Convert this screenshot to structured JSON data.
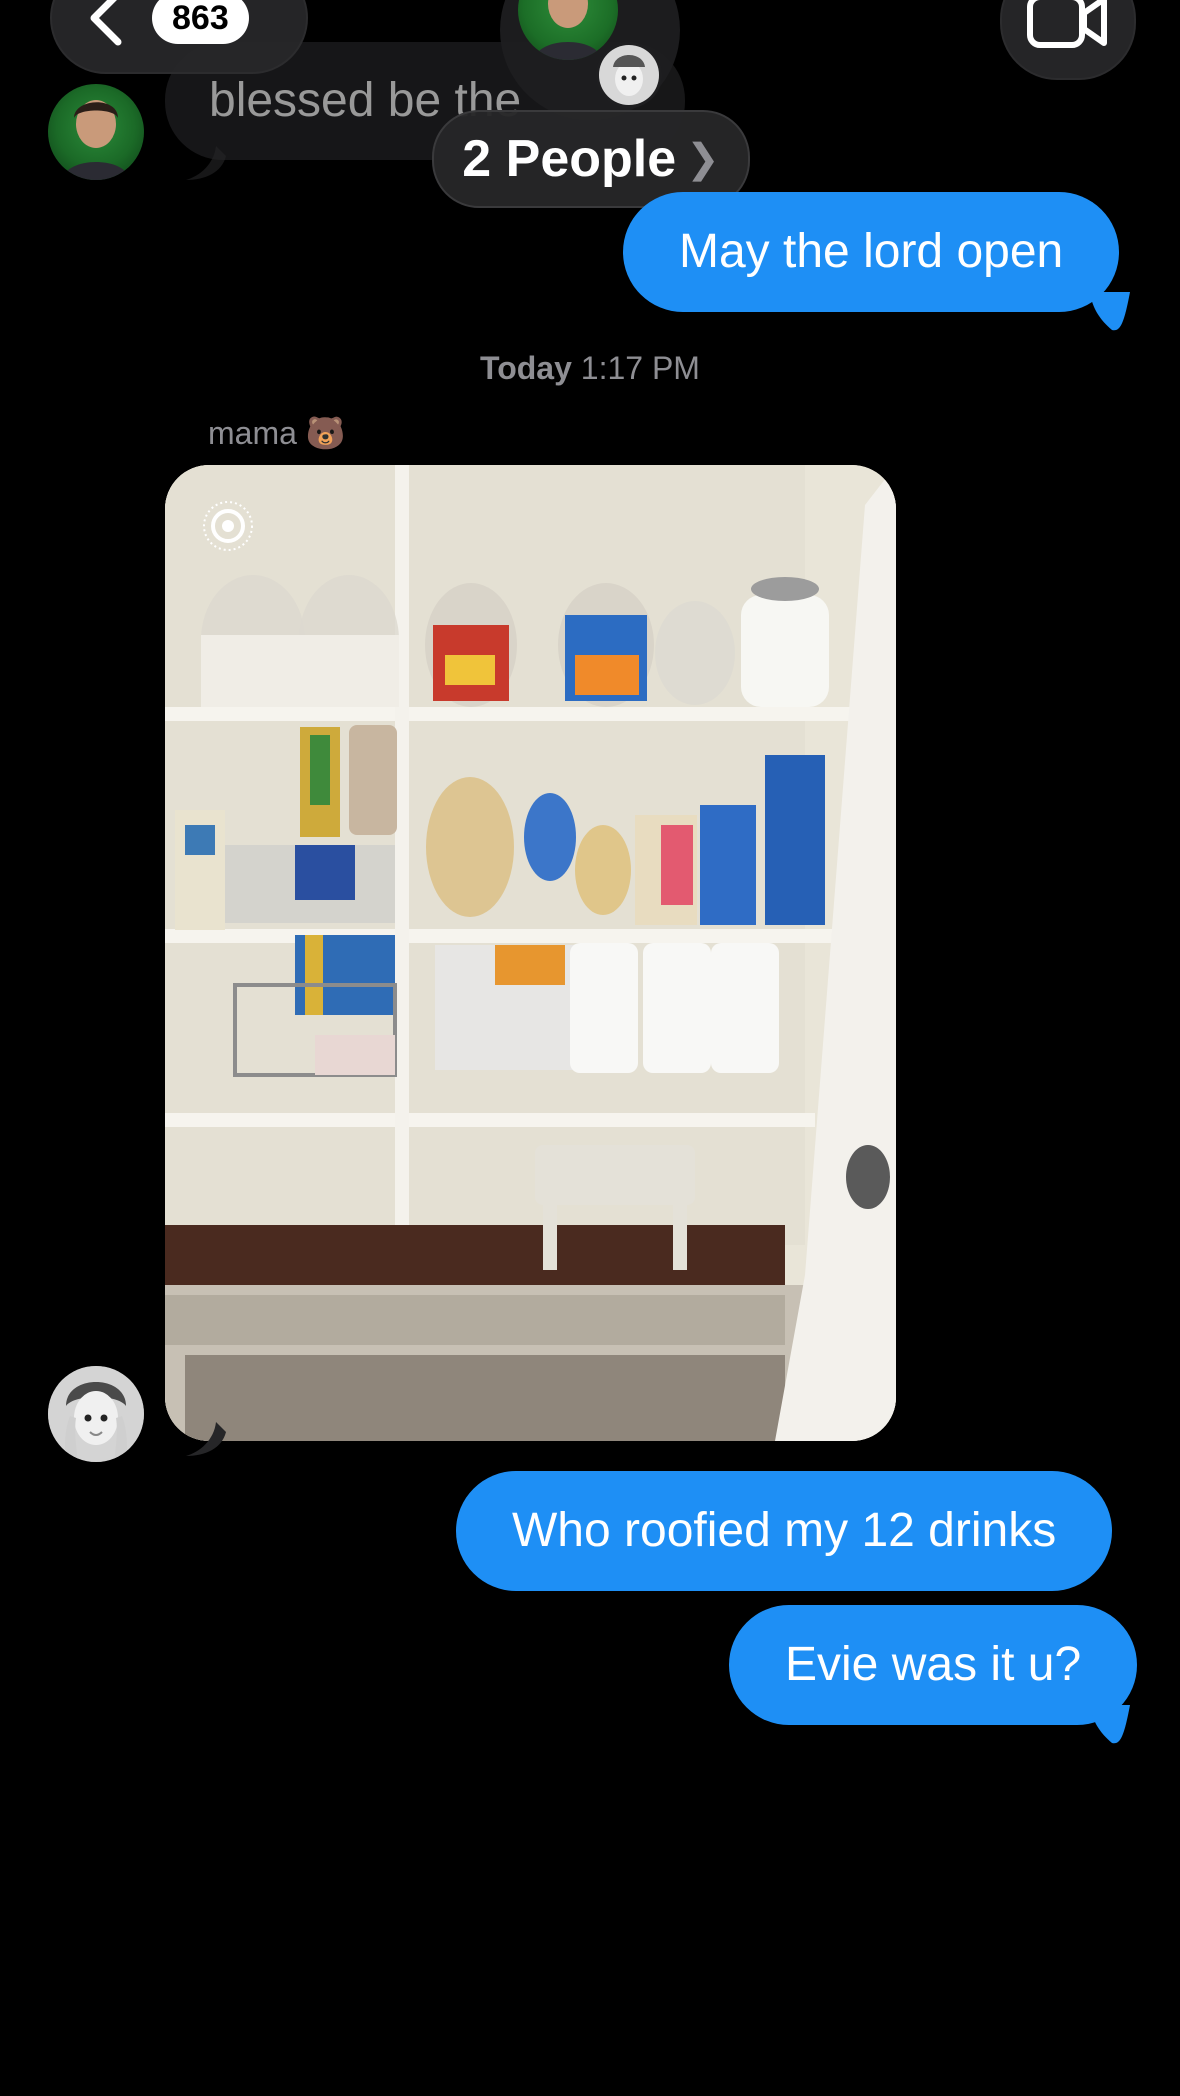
{
  "header": {
    "unread_count": "863",
    "group_label": "2 People",
    "icons": {
      "back": "chevron-left-icon",
      "video": "video-camera-icon",
      "disclosure": "chevron-right-icon"
    }
  },
  "messages": [
    {
      "direction": "in",
      "text": "blessed be the"
    },
    {
      "direction": "out",
      "text": "May the lord open"
    },
    {
      "type": "timestamp",
      "day": "Today",
      "time": "1:17 PM"
    },
    {
      "direction": "in",
      "sender": "mama 🐻",
      "attachment": "photo",
      "live_icon": "live-photo-icon"
    },
    {
      "direction": "out",
      "text": "Who roofied my 12 drinks"
    },
    {
      "direction": "out",
      "text": "Evie was it u?"
    }
  ],
  "colors": {
    "background": "#000000",
    "outgoing_bubble": "#1e8ff5",
    "incoming_bubble": "#262628",
    "muted_text": "#8e8e93"
  }
}
